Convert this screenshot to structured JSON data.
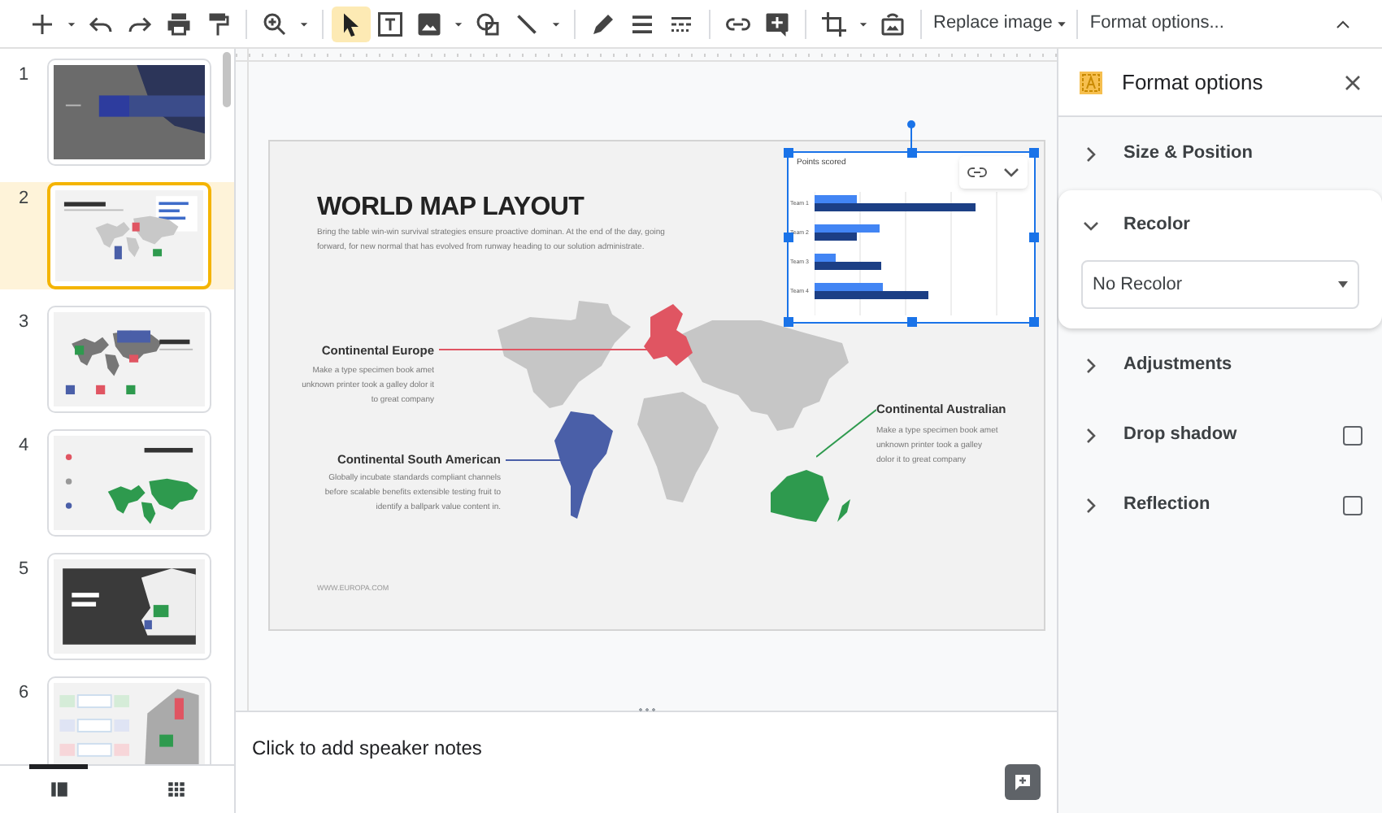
{
  "toolbar": {
    "groups": [
      [
        {
          "kind": "add",
          "selected": false
        },
        {
          "kind": "caret",
          "selected": false
        },
        {
          "kind": "undo",
          "selected": false
        },
        {
          "kind": "redo",
          "selected": false
        },
        {
          "kind": "print",
          "selected": false
        },
        {
          "kind": "paint",
          "selected": false
        }
      ],
      [
        {
          "kind": "zoom",
          "selected": false
        },
        {
          "kind": "caret",
          "selected": false
        }
      ],
      [
        {
          "kind": "select",
          "selected": true
        },
        {
          "kind": "textbox",
          "selected": false
        },
        {
          "kind": "image",
          "selected": false
        },
        {
          "kind": "caret",
          "selected": false
        },
        {
          "kind": "shape",
          "selected": false
        },
        {
          "kind": "line",
          "selected": false
        },
        {
          "kind": "caret",
          "selected": false
        }
      ],
      [
        {
          "kind": "pen",
          "selected": false
        },
        {
          "kind": "weight",
          "selected": false
        },
        {
          "kind": "dash",
          "selected": false
        }
      ],
      [
        {
          "kind": "link",
          "selected": false
        },
        {
          "kind": "comment",
          "selected": false
        }
      ],
      [
        {
          "kind": "crop",
          "selected": false
        },
        {
          "kind": "caret",
          "selected": false
        },
        {
          "kind": "reset",
          "selected": false
        }
      ]
    ],
    "menus": [
      "Replace image",
      "Format options..."
    ]
  },
  "slides": [
    {
      "number": "1",
      "kind": "dark",
      "selected": false
    },
    {
      "number": "2",
      "kind": "world",
      "selected": true
    },
    {
      "number": "3",
      "kind": "world-right",
      "selected": false
    },
    {
      "number": "4",
      "kind": "world-green",
      "selected": false
    },
    {
      "number": "5",
      "kind": "europe-dark",
      "selected": false
    },
    {
      "number": "6",
      "kind": "europe-table",
      "selected": false
    }
  ],
  "views": [
    {
      "kind": "list",
      "selected": true
    },
    {
      "kind": "grid",
      "selected": false
    }
  ],
  "slide": {
    "title": "WORLD MAP LAYOUT",
    "body": "Bring the table win-win survival strategies ensure proactive dominan. At the end of the day, going forward, for new normal that has evolved from runway heading to our solution administrate.",
    "callouts": [
      {
        "heading": "Continental Europe",
        "text": "Make a type specimen book amet unknown printer took a galley dolor it to great company",
        "color": "#e05562"
      },
      {
        "heading": "Continental South American",
        "text": "Globally incubate standards compliant channels before scalable benefits extensible testing fruit to identify a ballpark value content in.",
        "color": "#4a5fa8"
      },
      {
        "heading": "Continental Australian",
        "text": "Make a type specimen book amet unknown printer took a galley dolor it to great company",
        "color": "#2e9a4e"
      }
    ],
    "footer": "WWW.EUROPA.COM",
    "chart": {
      "title": "Points scored",
      "categories": [
        "Team 1",
        "Team 2",
        "Team 3",
        "Team 4"
      ]
    }
  },
  "speaker_notes": {
    "placeholder": "Click to add speaker notes"
  },
  "format_panel": {
    "title": "Format options",
    "sections": [
      {
        "label": "Size & Position",
        "expanded": false
      },
      {
        "label": "Recolor",
        "expanded": true,
        "dropdown": "No Recolor"
      },
      {
        "label": "Adjustments",
        "expanded": false
      },
      {
        "label": "Drop shadow",
        "expanded": false,
        "checked": false
      },
      {
        "label": "Reflection",
        "expanded": false,
        "checked": false
      }
    ]
  }
}
